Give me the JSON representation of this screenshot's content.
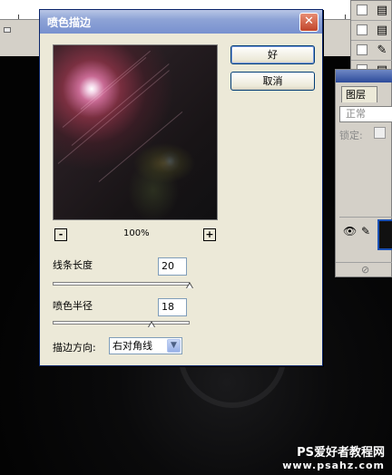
{
  "dialog": {
    "title": "喷色描边",
    "ok_label": "好",
    "cancel_label": "取消",
    "close_glyph": "✕",
    "zoom": {
      "minus": "-",
      "plus": "+",
      "level": "100%"
    },
    "stroke_length": {
      "label": "线条长度",
      "value": "20",
      "fraction": 1.0
    },
    "spray_radius": {
      "label": "喷色半径",
      "value": "18",
      "fraction": 0.72
    },
    "stroke_direction": {
      "label": "描边方向:",
      "selected": "右对角线"
    }
  },
  "layers_palette": {
    "tab_label": "图层",
    "blend_mode": "正常",
    "lock_label": "锁定:"
  },
  "watermark": {
    "line1": "PS爱好者教程网",
    "line2": "www.psahz.com"
  },
  "colors": {
    "dialog_bg": "#ece9d8",
    "titlebar": "#8ea3d6",
    "close_button": "#c0442a",
    "canvas": "#000000"
  }
}
